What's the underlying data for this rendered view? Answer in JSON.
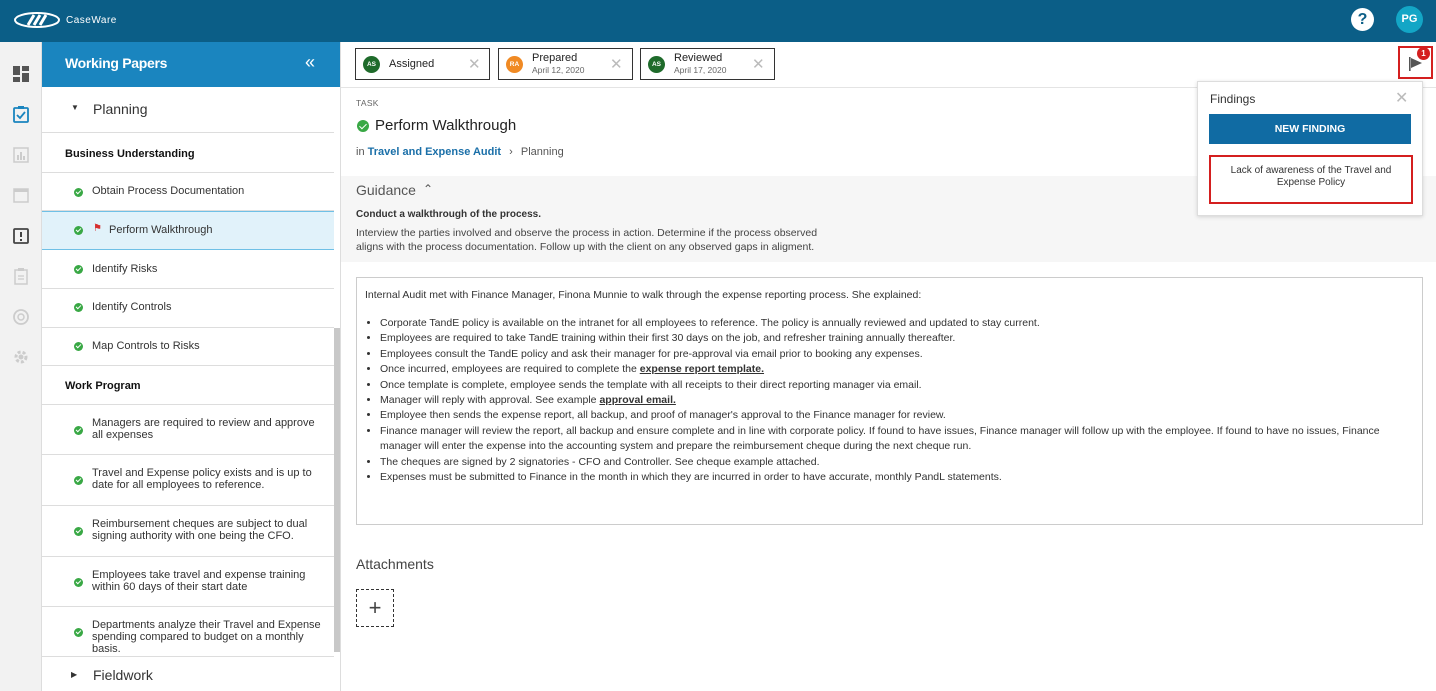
{
  "app": {
    "brand": "CaseWare",
    "help_label": "?",
    "user_initials": "PG"
  },
  "sidebar": {
    "title": "Working Papers",
    "collapse_label": "«",
    "groups": [
      {
        "label": "Planning",
        "caret": "▼"
      },
      {
        "label": "Fieldwork",
        "caret": "▶"
      }
    ],
    "sections": {
      "business_understanding": "Business Understanding",
      "work_program": "Work Program"
    },
    "items": [
      {
        "label": "Obtain Process Documentation"
      },
      {
        "label": "Perform Walkthrough"
      },
      {
        "label": "Identify Risks"
      },
      {
        "label": "Identify Controls"
      },
      {
        "label": "Map Controls to Risks"
      },
      {
        "label": "Managers are required to review and approve all expenses"
      },
      {
        "label": "Travel and Expense policy exists and is up to date for all employees to reference."
      },
      {
        "label": "Reimbursement cheques are subject to dual signing authority with one being the CFO."
      },
      {
        "label": "Employees take travel and expense training within 60 days of their start date"
      },
      {
        "label": "Departments analyze their Travel and Expense spending compared to budget on a monthly basis."
      }
    ]
  },
  "status": {
    "assigned": {
      "initials": "AS",
      "label": "Assigned",
      "color": "#1f6b2b"
    },
    "prepared": {
      "initials": "RA",
      "label": "Prepared",
      "date": "April 12, 2020",
      "color": "#f08a24"
    },
    "reviewed": {
      "initials": "AS",
      "label": "Reviewed",
      "date": "April 17, 2020",
      "color": "#1f6b2b"
    },
    "close_glyph": "✕"
  },
  "findings_flag": {
    "count": "1"
  },
  "task": {
    "kind_label": "TASK",
    "title": "Perform Walkthrough",
    "breadcrumb_prefix": "in",
    "breadcrumb_link": "Travel and Expense Audit",
    "breadcrumb_current": "Planning"
  },
  "guidance": {
    "title": "Guidance",
    "heading": "Conduct a walkthrough of the process.",
    "body": "Interview the parties involved and observe the process in action. Determine if the process observed aligns with the process documentation. Follow up with the client on any observed gaps in aligment."
  },
  "editor": {
    "intro": "Internal Audit met with Finance Manager, Finona Munnie to walk through the expense reporting process. She explained:",
    "bullets": [
      "Corporate TandE policy is available on the intranet for all employees to reference. The policy is annually reviewed and updated to stay current.",
      "Employees are required to take TandE training within their first 30 days on the job, and refresher training annually thereafter.",
      "Employees consult the TandE policy and ask their manager for pre-approval via email prior to booking any expenses.",
      "Once template is complete, employee sends the template with all receipts to their direct reporting manager via email.",
      "Employee then sends the expense report, all backup, and proof of manager's approval to the Finance manager for review.",
      "Finance manager will review the report, all backup and ensure complete and in line with corporate policy. If found to have issues, Finance manager will follow up with the employee. If found to have no issues, Finance manager will enter the expense into the accounting system and prepare the reimbursement cheque during the next cheque run.",
      "The cheques are signed by 2 signatories - CFO and Controller. See cheque example attached.",
      "Expenses must be submitted to Finance in the month in which they are incurred in order to have accurate, monthly PandL statements."
    ],
    "link_bullet_1_prefix": "Once incurred, employees are required to complete the ",
    "link_bullet_1_link": "expense report template.",
    "link_bullet_2_prefix": "Manager will reply with approval. See example ",
    "link_bullet_2_link": "approval email."
  },
  "attachments": {
    "title": "Attachments",
    "add_label": "+"
  },
  "findings": {
    "title": "Findings",
    "close_glyph": "✕",
    "new_button": "NEW FINDING",
    "items": [
      "Lack of awareness of the Travel and Expense Policy"
    ]
  }
}
